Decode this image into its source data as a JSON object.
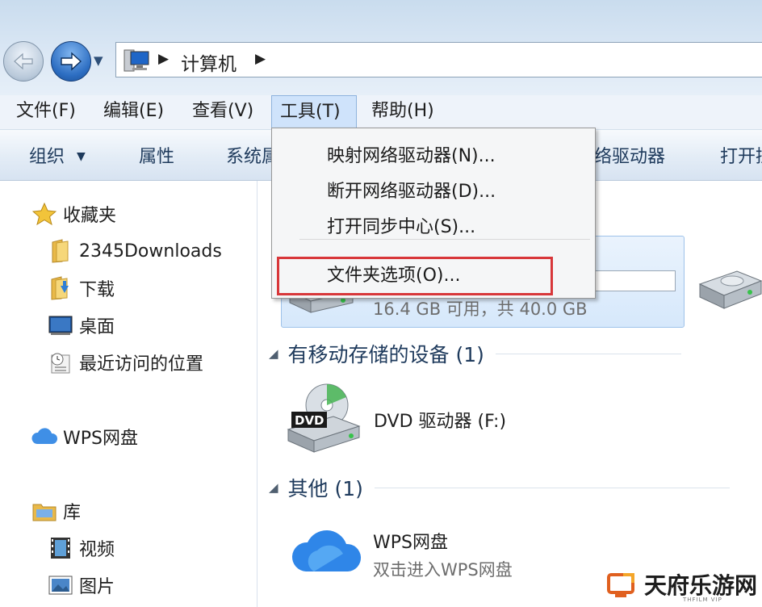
{
  "address_bar": {
    "location_icon": "computer-icon",
    "breadcrumbs": [
      "计算机"
    ]
  },
  "menu_bar": {
    "items": [
      "文件(F)",
      "编辑(E)",
      "查看(V)",
      "工具(T)",
      "帮助(H)"
    ],
    "active": "工具(T)"
  },
  "command_bar": {
    "items": [
      "组织",
      "属性",
      "系统属",
      "络驱动器",
      "打开控"
    ]
  },
  "tools_menu": {
    "items": [
      "映射网络驱动器(N)...",
      "断开网络驱动器(D)...",
      "打开同步中心(S)...",
      "文件夹选项(O)..."
    ],
    "highlighted_item": "文件夹选项(O)...",
    "highlight_color": "#d8373a"
  },
  "nav_pane": {
    "favorites": {
      "label": "收藏夹",
      "icon": "star-icon"
    },
    "favorites_items": [
      {
        "label": "2345Downloads",
        "icon": "folder-icon"
      },
      {
        "label": "下载",
        "icon": "download-folder-icon"
      },
      {
        "label": "桌面",
        "icon": "desktop-icon"
      },
      {
        "label": "最近访问的位置",
        "icon": "recent-places-icon"
      }
    ],
    "wps_cloud": {
      "label": "WPS网盘",
      "icon": "cloud-icon"
    },
    "libraries": {
      "label": "库",
      "icon": "library-icon"
    },
    "library_items": [
      {
        "label": "视频",
        "icon": "video-icon"
      },
      {
        "label": "图片",
        "icon": "picture-icon"
      }
    ]
  },
  "content": {
    "hard_drives": {
      "drive_c": {
        "free_text": "16.4 GB 可用，共 40.0 GB",
        "used_fraction": 0.59
      }
    },
    "removable_group": {
      "header": "有移动存储的设备 (1)",
      "items": [
        {
          "label": "DVD 驱动器 (F:)",
          "icon": "dvd-drive-icon",
          "badge": "DVD"
        }
      ]
    },
    "other_group": {
      "header": "其他 (1)",
      "items": [
        {
          "label": "WPS网盘",
          "sublabel": "双击进入WPS网盘",
          "icon": "wps-cloud-icon"
        }
      ]
    }
  },
  "watermark": {
    "text": "天府乐游网",
    "subtext": "THFILM VIP"
  }
}
